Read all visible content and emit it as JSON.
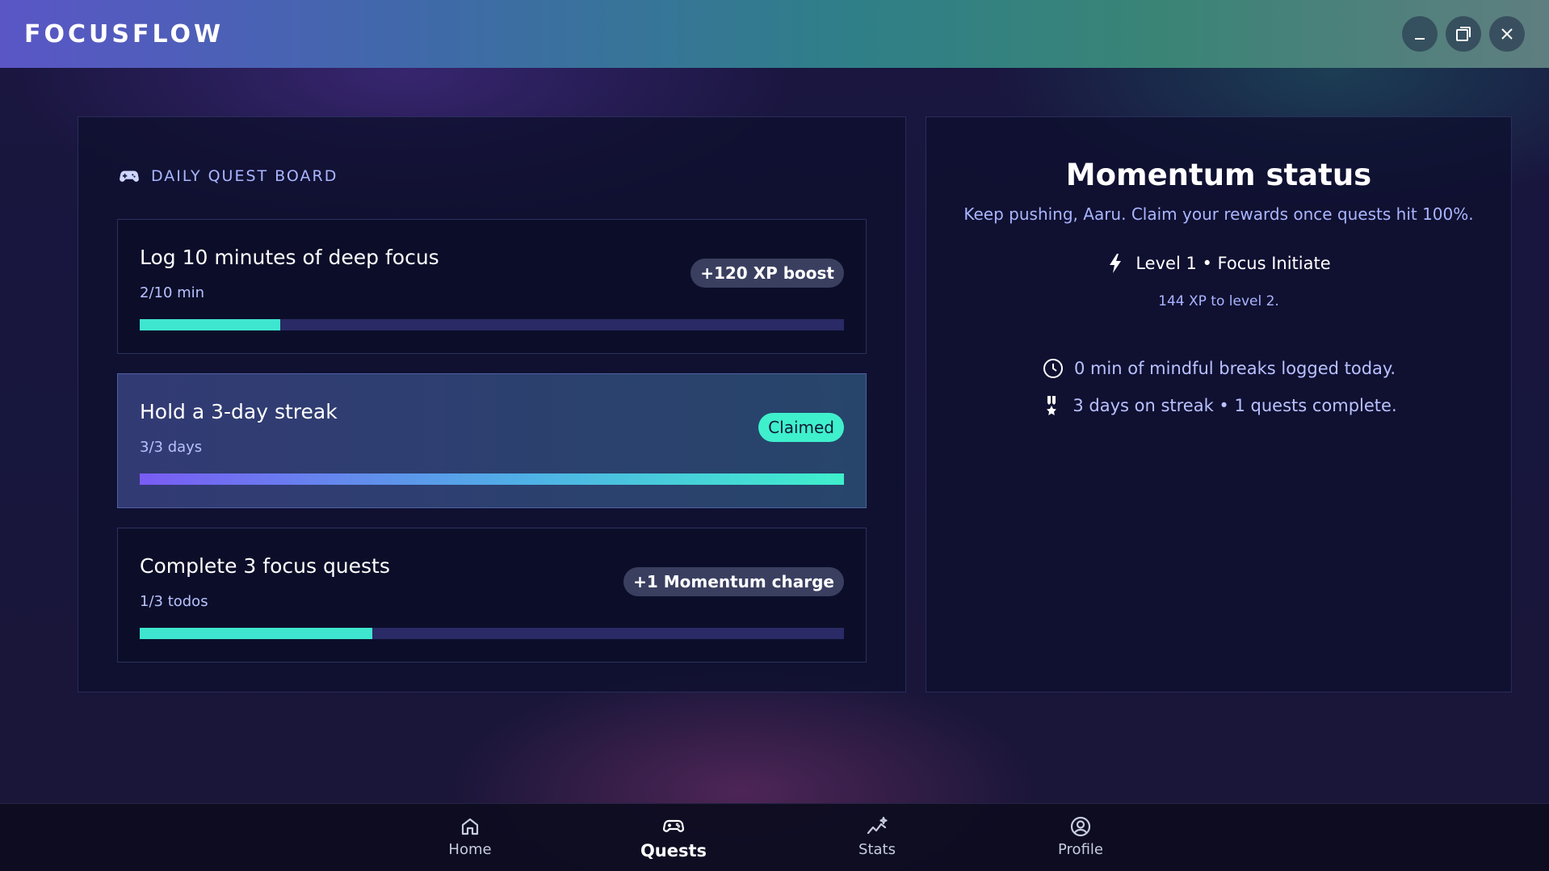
{
  "app": {
    "title": "FOCUSFLOW"
  },
  "window_controls": {
    "minimize_icon": "minimize-icon",
    "maximize_icon": "maximize-icon",
    "close_icon": "close-icon"
  },
  "quest_board": {
    "header": "DAILY QUEST BOARD",
    "header_icon": "gamepad-icon",
    "quests": [
      {
        "title": "Log 10 minutes of deep focus",
        "progress_text": "2/10 min",
        "reward": "+120 XP boost",
        "progress": 0.2,
        "claimed": false
      },
      {
        "title": "Hold a 3-day streak",
        "progress_text": "3/3 days",
        "reward": "Claimed",
        "progress": 1.0,
        "claimed": true
      },
      {
        "title": "Complete 3 focus quests",
        "progress_text": "1/3 todos",
        "reward": "+1 Momentum charge",
        "progress": 0.33,
        "claimed": false
      }
    ]
  },
  "momentum": {
    "title": "Momentum status",
    "subtitle": "Keep pushing, Aaru. Claim your rewards once quests hit 100%.",
    "level": "Level 1 • Focus Initiate",
    "level_icon": "lightning-icon",
    "xp_to_next": "144 XP to level 2.",
    "breaks": "0 min of mindful breaks logged today.",
    "breaks_icon": "clock-icon",
    "streak": "3 days on streak • 1 quests complete.",
    "streak_icon": "medal-icon"
  },
  "nav": {
    "items": [
      {
        "label": "Home",
        "icon": "home-icon",
        "active": false
      },
      {
        "label": "Quests",
        "icon": "gamepad-icon",
        "active": true
      },
      {
        "label": "Stats",
        "icon": "stats-icon",
        "active": false
      },
      {
        "label": "Profile",
        "icon": "profile-icon",
        "active": false
      }
    ]
  },
  "colors": {
    "accent_teal": "#3fe6cf",
    "accent_purple": "#7a5cf5",
    "text_muted": "#a9b6ff"
  }
}
